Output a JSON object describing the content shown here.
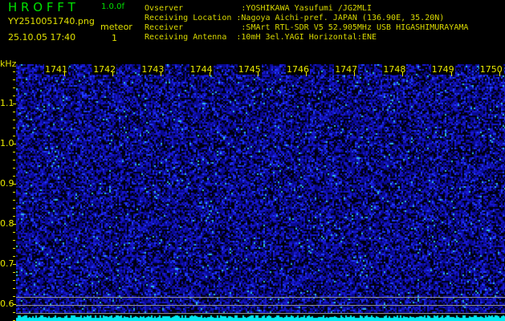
{
  "header": {
    "app_title": "H R O F F T",
    "version": "1.0.0f",
    "filename": "YY2510051740.png",
    "datetime": "25.10.05 17:40",
    "mode_label": "meteor",
    "count": "1"
  },
  "info": {
    "lines": [
      "Ovserver            :YOSHIKAWA Yasufumi /JG2MLI",
      "Receiving Location :Nagoya Aichi-pref. JAPAN (136.90E, 35.20N)",
      "Receiver            :SMArt RTL-SDR V5 52.905MHz USB HIGASHIMURAYAMA",
      "Receiving Antenna  :10mH 3el.YAGI Horizontal:ENE"
    ]
  },
  "axis": {
    "y_unit": "kHz",
    "y_ticks": [
      "1.1",
      "1.0",
      "0.9",
      "0.8",
      "0.7",
      "0.6"
    ],
    "time_ticks": [
      "1741",
      "1742",
      "1743",
      "1744",
      "1745",
      "1746",
      "1747",
      "1748",
      "1749",
      "1750"
    ]
  },
  "colors": {
    "text_green": "#00e000",
    "text_yellow": "#e8e800",
    "noise": "#1010c0",
    "baseline": "#00e8f0"
  }
}
